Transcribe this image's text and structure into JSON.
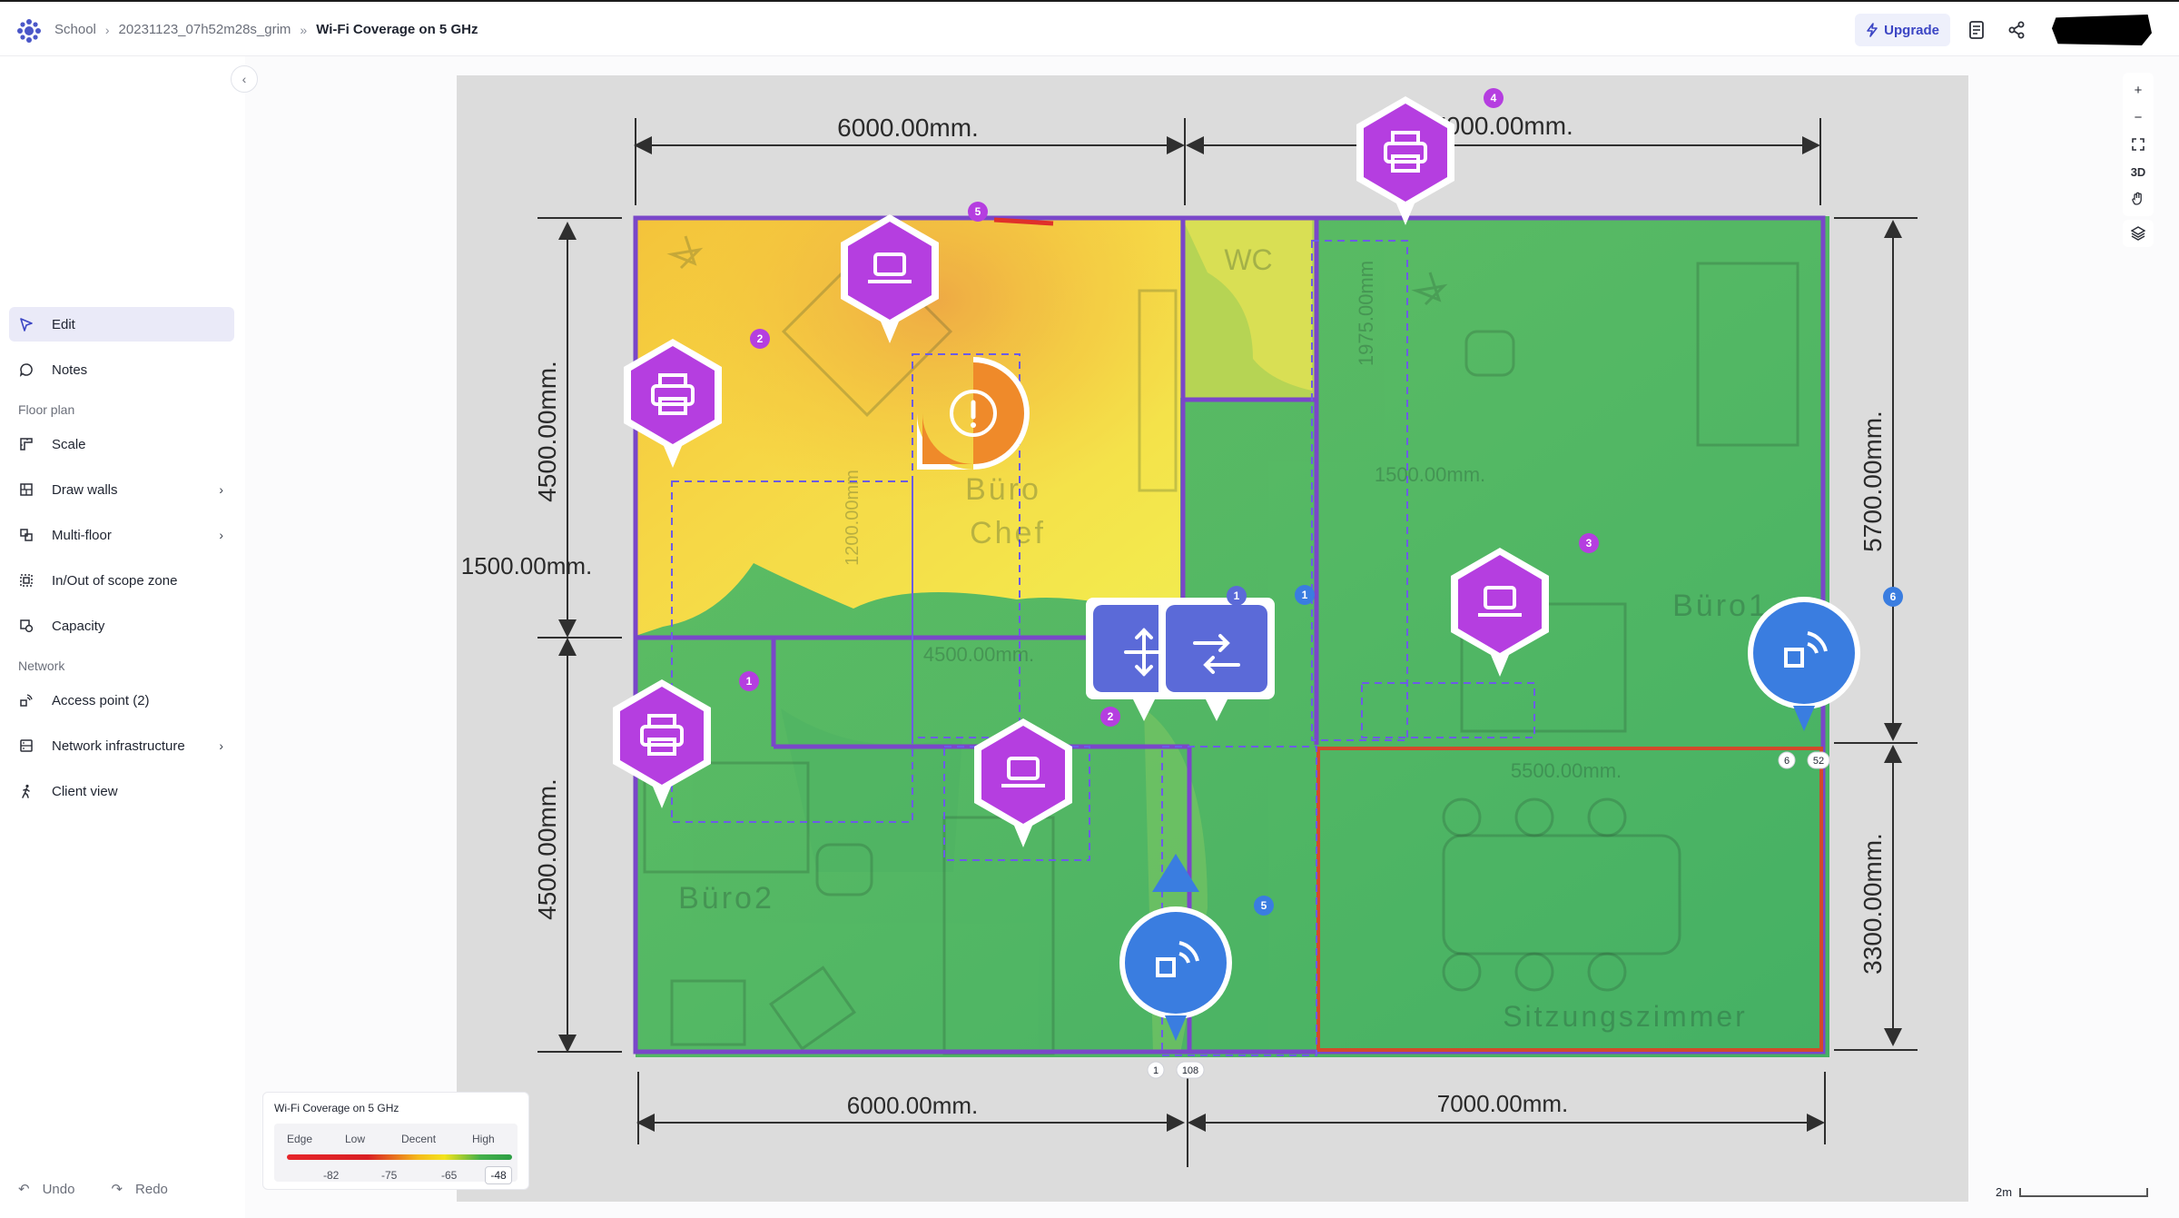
{
  "breadcrumb": {
    "items": [
      "School",
      "20231123_07h52m28s_grim"
    ],
    "current": "Wi-Fi Coverage on 5 GHz"
  },
  "header": {
    "upgrade_label": "Upgrade"
  },
  "sidebar": {
    "edit_label": "Edit",
    "notes_label": "Notes",
    "floor_plan_section": "Floor plan",
    "scale_label": "Scale",
    "draw_walls_label": "Draw walls",
    "multi_floor_label": "Multi-floor",
    "scope_zone_label": "In/Out of scope zone",
    "capacity_label": "Capacity",
    "network_section": "Network",
    "access_point_label": "Access point (2)",
    "network_infra_label": "Network infrastructure",
    "client_view_label": "Client view",
    "undo_label": "Undo",
    "redo_label": "Redo"
  },
  "map": {
    "tools": [
      "+",
      "−",
      "3D"
    ],
    "dimensions": {
      "top_left": "6000.00mm.",
      "top_right": "7000.00mm.",
      "bottom_left": "6000.00mm.",
      "bottom_right": "7000.00mm.",
      "left_top": "4500.00mm.",
      "left_mid": "1500.00mm.",
      "left_bottom": "4500.00mm.",
      "right_top": "5700.00mm.",
      "right_bottom": "3300.00mm.",
      "inner_1975": "1975.00mm",
      "inner_1500": "1500.00mm.",
      "inner_4500": "4500.00mm.",
      "inner_5500": "5500.00mm.",
      "inner_1200": "1200.00mm"
    },
    "room_labels": {
      "wc": "WC",
      "buero1": "Büro1",
      "buero2": "Büro2",
      "buero_chef_1": "Büro",
      "buero_chef_2": "Chef",
      "sitzung": "Sitzungszimmer"
    },
    "badges": {
      "purple_4": "4",
      "purple_5": "5",
      "purple_2": "2",
      "purple_3": "3",
      "purple_1": "1",
      "purple_2b": "2",
      "blue_1": "1",
      "blue_1b": "1",
      "blue_6": "6",
      "blue_5": "5"
    },
    "chips": {
      "ap_right_a": "6",
      "ap_right_b": "52",
      "ap_bottom_a": "1",
      "ap_bottom_b": "108"
    },
    "colors": {
      "accent": "#3b45c4",
      "device_purple": "#b53ee0",
      "ap_blue": "#3a7de0",
      "infra_blue": "#5b6ad8",
      "warning_orange": "#ef8a2a",
      "coverage_green": "#3fb25a",
      "coverage_yellow": "#f2e52e"
    }
  },
  "legend": {
    "title": "Wi-Fi Coverage on 5 GHz",
    "categories": [
      "Edge",
      "Low",
      "Decent",
      "High"
    ],
    "values": [
      "-82",
      "-75",
      "-65"
    ],
    "current_value": "-48"
  },
  "scale_label": "2m"
}
